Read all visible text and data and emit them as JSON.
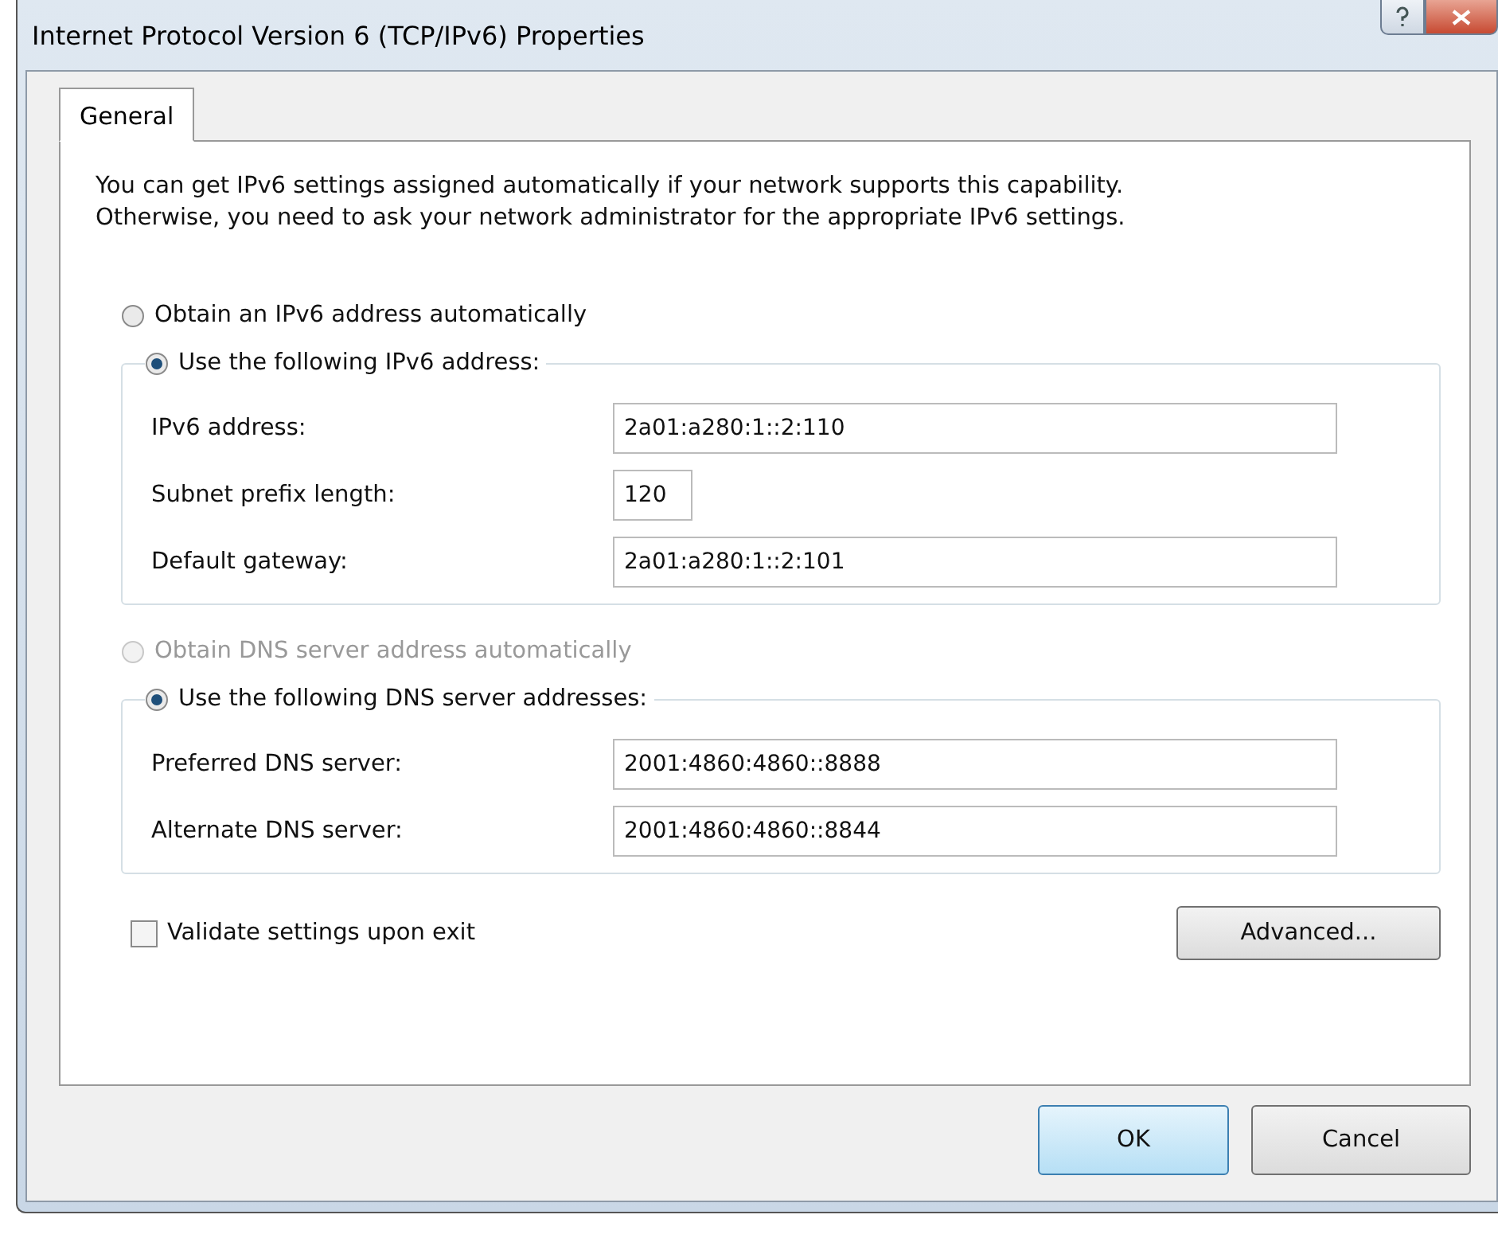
{
  "window": {
    "title": "Internet Protocol Version 6 (TCP/IPv6) Properties",
    "controls": [
      {
        "kind": "help"
      },
      {
        "kind": "close"
      }
    ]
  },
  "tabs": [
    {
      "label": "General",
      "selected": true
    }
  ],
  "intro_lines": [
    "You can get IPv6 settings assigned automatically if your network supports this capability.",
    "Otherwise, you need to ask your network administrator for the appropriate IPv6 settings."
  ],
  "sections": [
    {
      "auto_option": {
        "label": "Obtain an IPv6 address automatically",
        "selected": false,
        "disabled": false
      },
      "manual_option": {
        "label": "Use the following IPv6 address:",
        "selected": true,
        "disabled": false
      },
      "fields": [
        {
          "label": "IPv6 address:",
          "value": "2a01:a280:1::2:110",
          "kind": "wide"
        },
        {
          "label": "Subnet prefix length:",
          "value": "120",
          "kind": "short"
        },
        {
          "label": "Default gateway:",
          "value": "2a01:a280:1::2:101",
          "kind": "wide"
        }
      ]
    },
    {
      "auto_option": {
        "label": "Obtain DNS server address automatically",
        "selected": false,
        "disabled": true
      },
      "manual_option": {
        "label": "Use the following DNS server addresses:",
        "selected": true,
        "disabled": false
      },
      "fields": [
        {
          "label": "Preferred DNS server:",
          "value": "2001:4860:4860::8888",
          "kind": "wide"
        },
        {
          "label": "Alternate DNS server:",
          "value": "2001:4860:4860::8844",
          "kind": "wide"
        }
      ]
    }
  ],
  "validate": {
    "label": "Validate settings upon exit",
    "checked": false
  },
  "advanced_button": "Advanced...",
  "buttons": [
    {
      "label": "OK",
      "default": true
    },
    {
      "label": "Cancel",
      "default": false
    }
  ]
}
